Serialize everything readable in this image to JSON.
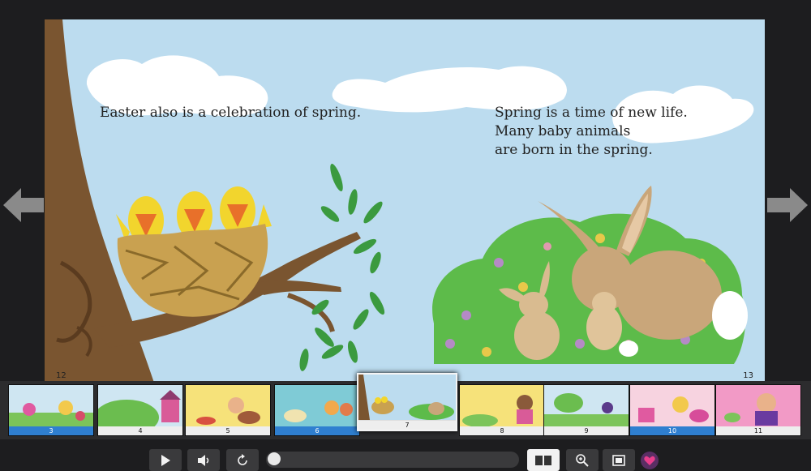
{
  "spread": {
    "left_text": [
      "Easter also is a celebration of spring."
    ],
    "right_text": [
      "Spring is a time of new life.",
      "Many baby animals",
      "are born in the spring."
    ],
    "left_page_number": "12",
    "right_page_number": "13"
  },
  "navigation": {
    "prev_icon": "arrow-left-icon",
    "next_icon": "arrow-right-icon"
  },
  "thumbnails": [
    {
      "label": "3",
      "selected": true,
      "current": false
    },
    {
      "label": "4",
      "selected": false,
      "current": false
    },
    {
      "label": "5",
      "selected": false,
      "current": false
    },
    {
      "label": "6",
      "selected": true,
      "current": false
    },
    {
      "label": "7",
      "selected": false,
      "current": true
    },
    {
      "label": "8",
      "selected": false,
      "current": false
    },
    {
      "label": "9",
      "selected": false,
      "current": false
    },
    {
      "label": "10",
      "selected": true,
      "current": false
    },
    {
      "label": "11",
      "selected": false,
      "current": false
    }
  ],
  "controls": {
    "play_icon": "play-icon",
    "volume_icon": "speaker-icon",
    "replay_icon": "replay-icon",
    "layout_icon": "two-page-icon",
    "zoom_icon": "zoom-in-icon",
    "fullscreen_icon": "fullscreen-icon",
    "favorite_icon": "heart-icon",
    "progress_fraction": 0.0
  },
  "colors": {
    "sky": "#bcdcef",
    "selected_tab": "#2f7fd0",
    "favorite": "#5a2e64"
  }
}
